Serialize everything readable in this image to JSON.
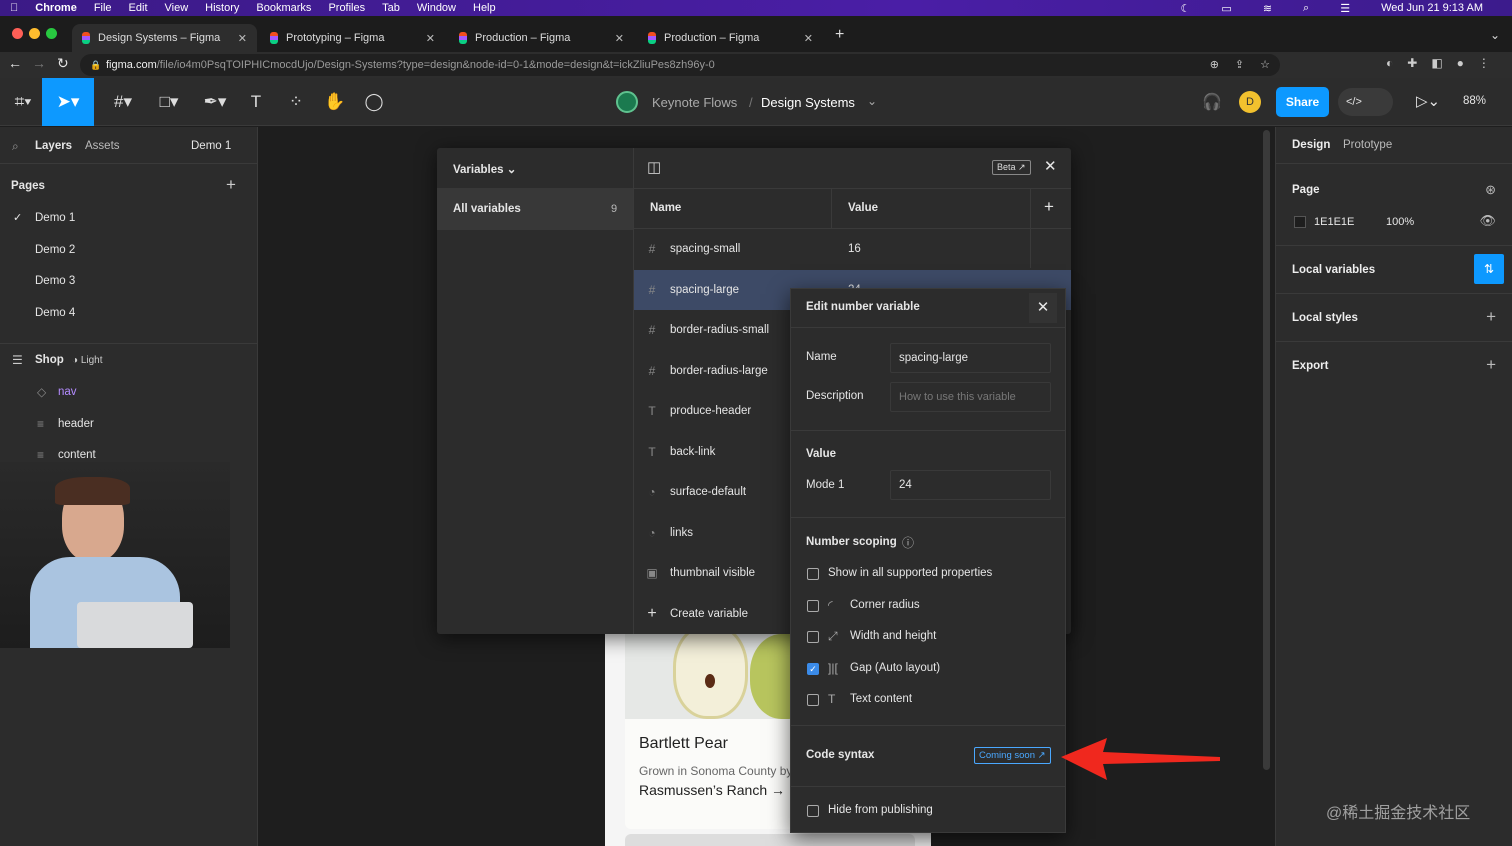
{
  "menubar": {
    "apple": "",
    "app": "Chrome",
    "items": [
      "File",
      "Edit",
      "View",
      "History",
      "Bookmarks",
      "Profiles",
      "Tab",
      "Window",
      "Help"
    ],
    "clock": "Wed Jun 21  9:13 AM"
  },
  "tabs": [
    {
      "label": "Design Systems – Figma",
      "active": true
    },
    {
      "label": "Prototyping – Figma"
    },
    {
      "label": "Production – Figma"
    },
    {
      "label": "Production – Figma"
    }
  ],
  "url": {
    "host": "figma.com",
    "path": "/file/io4m0PsqTOIPHICmocdUjo/Design-Systems?type=design&node-id=0-1&mode=design&t=ickZliuPes8zh96y-0"
  },
  "figma": {
    "project": "Keynote Flows",
    "separator": "/",
    "file": "Design Systems",
    "avatar": "D",
    "share": "Share",
    "zoom": "88%"
  },
  "left": {
    "tabs": [
      "Layers",
      "Assets"
    ],
    "page_select": "Demo 1",
    "pages_title": "Pages",
    "pages": [
      "Demo 1",
      "Demo 2",
      "Demo 3",
      "Demo 4"
    ],
    "frame": "Shop",
    "frame_mode": "Light",
    "layers": [
      "nav",
      "header",
      "content"
    ]
  },
  "right": {
    "tabs": [
      "Design",
      "Prototype"
    ],
    "page_title": "Page",
    "page_color": "1E1E1E",
    "page_opacity": "100%",
    "local_variables": "Local variables",
    "local_styles": "Local styles",
    "export": "Export"
  },
  "variables": {
    "title": "Variables",
    "collection": "All variables",
    "count": "9",
    "beta": "Beta",
    "col_name": "Name",
    "col_value": "Value",
    "rows": [
      {
        "icon": "#",
        "name": "spacing-small",
        "value": "16"
      },
      {
        "icon": "#",
        "name": "spacing-large",
        "value": "24"
      },
      {
        "icon": "#",
        "name": "border-radius-small",
        "value": ""
      },
      {
        "icon": "#",
        "name": "border-radius-large",
        "value": ""
      },
      {
        "icon": "T",
        "name": "produce-header",
        "value": ""
      },
      {
        "icon": "T",
        "name": "back-link",
        "value": ""
      },
      {
        "icon": "◔",
        "name": "surface-default",
        "value": ""
      },
      {
        "icon": "◔",
        "name": "links",
        "value": ""
      },
      {
        "icon": "▣",
        "name": "thumbnail visible",
        "value": ""
      }
    ],
    "create": "Create variable"
  },
  "edit": {
    "title": "Edit number variable",
    "name_label": "Name",
    "name_value": "spacing-large",
    "desc_label": "Description",
    "desc_placeholder": "How to use this variable",
    "value_title": "Value",
    "mode_label": "Mode 1",
    "mode_value": "24",
    "scoping_title": "Number scoping",
    "scopes": [
      {
        "label": "Show in all supported properties",
        "checked": false,
        "icon": ""
      },
      {
        "label": "Corner radius",
        "checked": false,
        "icon": "◜"
      },
      {
        "label": "Width and height",
        "checked": false,
        "icon": "⤢"
      },
      {
        "label": "Gap (Auto layout)",
        "checked": true,
        "icon": "]|["
      },
      {
        "label": "Text content",
        "checked": false,
        "icon": "T"
      }
    ],
    "code_syntax": "Code syntax",
    "coming_soon": "Coming soon",
    "hide": "Hide from publishing"
  },
  "canvas": {
    "card_title": "Bartlett Pear",
    "card_sub": "Grown in Sonoma County by",
    "card_link": "Rasmussen’s Ranch →"
  },
  "watermark": "@稀土掘金技术社区",
  "colors": {
    "accent": "#0d99ff",
    "menubar": "#3f1c95",
    "arrow": "#f0281e",
    "panel": "#2c2c2c",
    "canvas": "#1e1e1e"
  }
}
